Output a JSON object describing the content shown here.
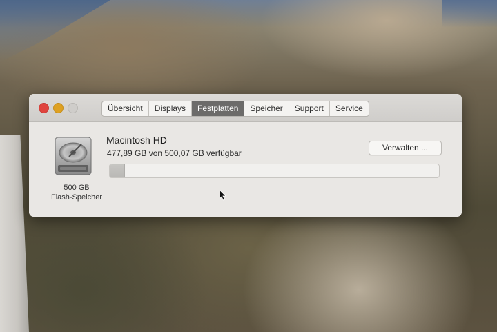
{
  "window": {
    "tabs": [
      {
        "label": "Übersicht",
        "active": false
      },
      {
        "label": "Displays",
        "active": false
      },
      {
        "label": "Festplatten",
        "active": true
      },
      {
        "label": "Speicher",
        "active": false
      },
      {
        "label": "Support",
        "active": false
      },
      {
        "label": "Service",
        "active": false
      }
    ]
  },
  "disk": {
    "icon": "hard-drive-icon",
    "size_label": "500 GB",
    "type_label": "Flash-Speicher",
    "volume_name": "Macintosh HD",
    "availability": "477,89 GB von 500,07 GB verfügbar",
    "manage_button": "Verwalten ...",
    "used_fraction": 0.044
  },
  "colors": {
    "close": "#e0443e",
    "minimize": "#dea123",
    "active_tab": "#6c6b6a"
  }
}
